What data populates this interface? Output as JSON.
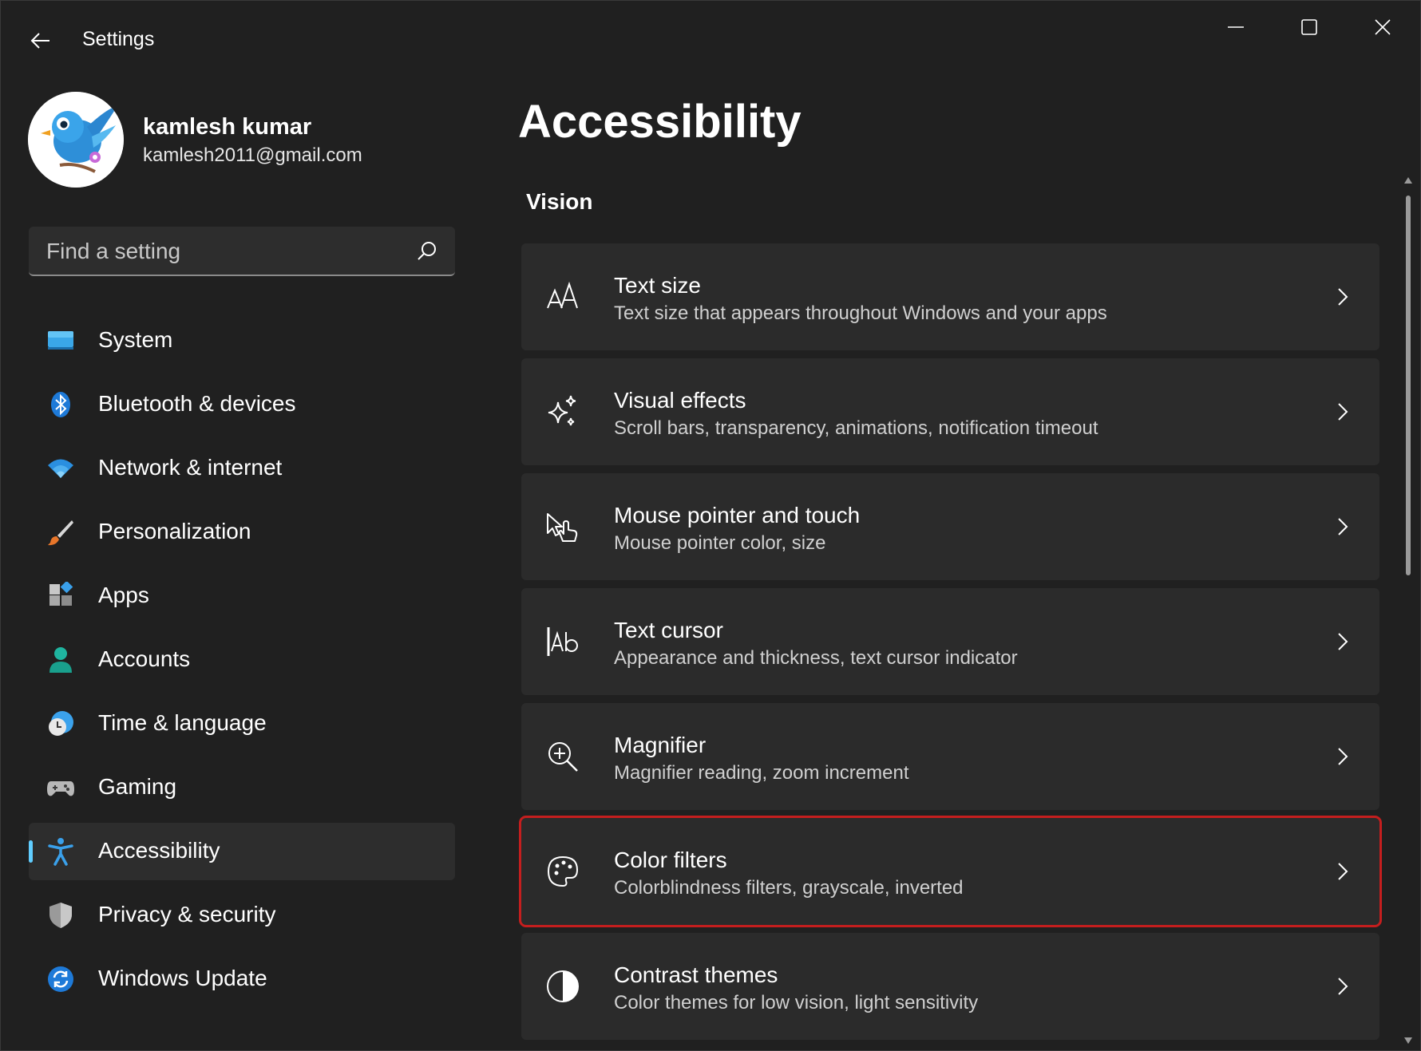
{
  "window": {
    "title": "Settings"
  },
  "user": {
    "name": "kamlesh kumar",
    "email": "kamlesh2011@gmail.com"
  },
  "search": {
    "placeholder": "Find a setting"
  },
  "sidebar": {
    "items": [
      {
        "label": "System",
        "icon": "system-icon"
      },
      {
        "label": "Bluetooth & devices",
        "icon": "bluetooth-icon"
      },
      {
        "label": "Network & internet",
        "icon": "wifi-icon"
      },
      {
        "label": "Personalization",
        "icon": "brush-icon"
      },
      {
        "label": "Apps",
        "icon": "apps-icon"
      },
      {
        "label": "Accounts",
        "icon": "person-icon"
      },
      {
        "label": "Time & language",
        "icon": "clock-globe-icon"
      },
      {
        "label": "Gaming",
        "icon": "gamepad-icon"
      },
      {
        "label": "Accessibility",
        "icon": "accessibility-icon",
        "selected": true
      },
      {
        "label": "Privacy & security",
        "icon": "shield-icon"
      },
      {
        "label": "Windows Update",
        "icon": "update-icon"
      }
    ]
  },
  "main": {
    "title": "Accessibility",
    "section": "Vision",
    "cards": [
      {
        "title": "Text size",
        "subtitle": "Text size that appears throughout Windows and your apps",
        "icon": "text-size-icon"
      },
      {
        "title": "Visual effects",
        "subtitle": "Scroll bars, transparency, animations, notification timeout",
        "icon": "sparkle-icon"
      },
      {
        "title": "Mouse pointer and touch",
        "subtitle": "Mouse pointer color, size",
        "icon": "pointer-touch-icon"
      },
      {
        "title": "Text cursor",
        "subtitle": "Appearance and thickness, text cursor indicator",
        "icon": "text-cursor-icon"
      },
      {
        "title": "Magnifier",
        "subtitle": "Magnifier reading, zoom increment",
        "icon": "magnifier-icon"
      },
      {
        "title": "Color filters",
        "subtitle": "Colorblindness filters, grayscale, inverted",
        "icon": "palette-icon",
        "highlighted": true
      },
      {
        "title": "Contrast themes",
        "subtitle": "Color themes for low vision, light sensitivity",
        "icon": "contrast-icon"
      }
    ]
  },
  "colors": {
    "background": "#202020",
    "card": "#2b2b2b",
    "accent": "#60cdff",
    "highlight_border": "#c41e1e"
  }
}
